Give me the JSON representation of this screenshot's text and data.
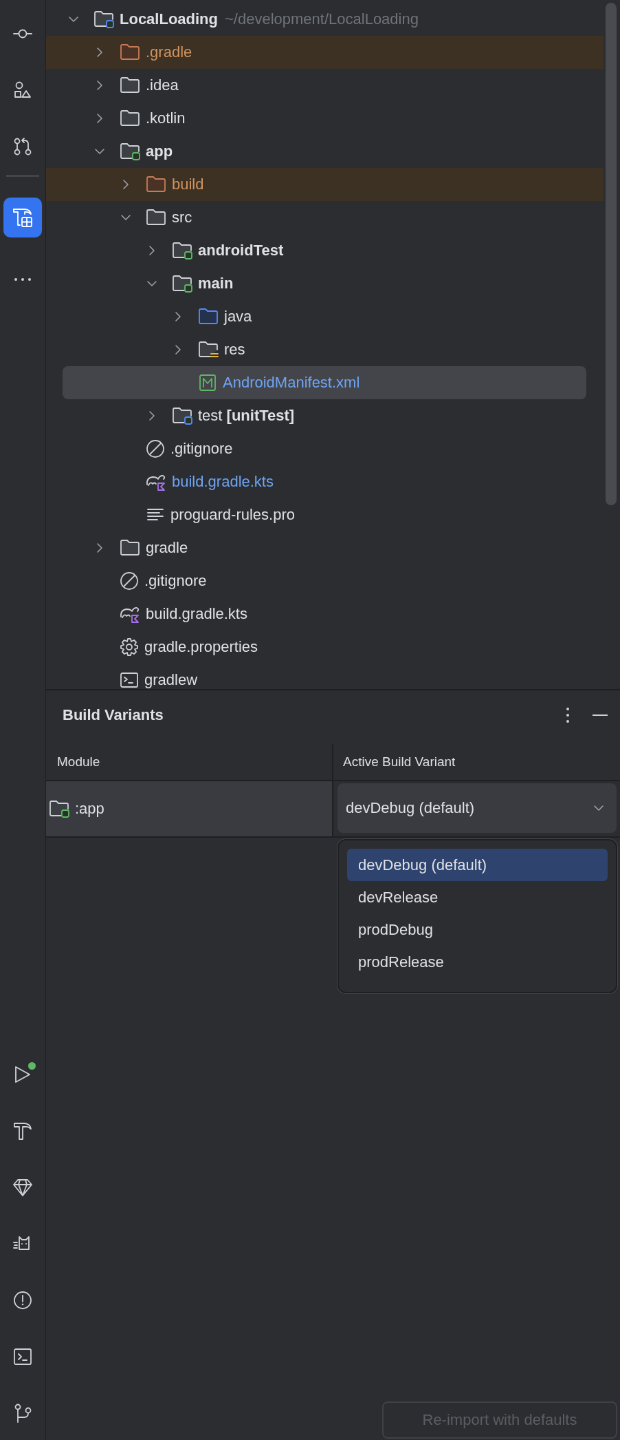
{
  "tool_strip": {
    "top": [
      {
        "kind": "commit",
        "selected": false
      },
      {
        "kind": "structure",
        "selected": false
      },
      {
        "kind": "pull-requests",
        "selected": false
      }
    ],
    "middle": [
      {
        "kind": "build-variants",
        "selected": true
      },
      {
        "kind": "more",
        "selected": false
      }
    ],
    "bottom": [
      {
        "kind": "run",
        "selected": false,
        "running": true
      },
      {
        "kind": "build",
        "selected": false,
        "running": false
      },
      {
        "kind": "gem",
        "selected": false,
        "running": false
      },
      {
        "kind": "logcat",
        "selected": false,
        "running": false
      },
      {
        "kind": "problems",
        "selected": false,
        "running": false
      },
      {
        "kind": "terminal",
        "selected": false,
        "running": false
      },
      {
        "kind": "git",
        "selected": false,
        "running": false
      }
    ]
  },
  "tree": [
    {
      "kind": "project",
      "label": "LocalLoading",
      "hint": "~/development/LocalLoading",
      "bold": true,
      "expanded": true,
      "selected": false,
      "excluded": false,
      "modified": false,
      "children": [
        {
          "kind": "folder",
          "label": ".gradle",
          "bold": false,
          "expanded": false,
          "selected": false,
          "excluded": true,
          "modified": false
        },
        {
          "kind": "folder",
          "label": ".idea",
          "bold": false,
          "expanded": false,
          "selected": false,
          "excluded": false,
          "modified": false
        },
        {
          "kind": "folder",
          "label": ".kotlin",
          "bold": false,
          "expanded": false,
          "selected": false,
          "excluded": false,
          "modified": false
        },
        {
          "kind": "module",
          "label": "app",
          "bold": true,
          "expanded": true,
          "selected": false,
          "excluded": false,
          "modified": false,
          "children": [
            {
              "kind": "folder",
              "label": "build",
              "bold": false,
              "expanded": false,
              "selected": false,
              "excluded": true,
              "modified": false
            },
            {
              "kind": "folder",
              "label": "src",
              "bold": false,
              "expanded": true,
              "selected": false,
              "excluded": false,
              "modified": false,
              "children": [
                {
                  "kind": "module",
                  "label": "androidTest",
                  "bold": true,
                  "expanded": false,
                  "selected": false,
                  "excluded": false,
                  "modified": false
                },
                {
                  "kind": "module",
                  "label": "main",
                  "bold": true,
                  "expanded": true,
                  "selected": false,
                  "excluded": false,
                  "modified": false,
                  "children": [
                    {
                      "kind": "source",
                      "label": "java",
                      "bold": false,
                      "expanded": false,
                      "selected": false,
                      "excluded": false,
                      "modified": false
                    },
                    {
                      "kind": "resources",
                      "label": "res",
                      "bold": false,
                      "expanded": false,
                      "selected": false,
                      "excluded": false,
                      "modified": false
                    },
                    {
                      "kind": "manifest",
                      "label": "AndroidManifest.xml",
                      "bold": false,
                      "selected": true,
                      "excluded": false,
                      "modified": true
                    }
                  ]
                },
                {
                  "kind": "test-root",
                  "label": "test **[unitTest]**",
                  "bold": false,
                  "expanded": false,
                  "selected": false,
                  "excluded": false,
                  "modified": false
                }
              ]
            },
            {
              "kind": "ignore",
              "label": ".gitignore",
              "bold": false,
              "selected": false,
              "excluded": false,
              "modified": false
            },
            {
              "kind": "gradle",
              "label": "build.gradle.kts",
              "bold": false,
              "selected": false,
              "excluded": false,
              "modified": true
            },
            {
              "kind": "text",
              "label": "proguard-rules.pro",
              "bold": false,
              "selected": false,
              "excluded": false,
              "modified": false
            }
          ]
        },
        {
          "kind": "folder",
          "label": "gradle",
          "bold": false,
          "expanded": false,
          "selected": false,
          "excluded": false,
          "modified": false
        },
        {
          "kind": "ignore",
          "label": ".gitignore",
          "bold": false,
          "selected": false,
          "excluded": false,
          "modified": false
        },
        {
          "kind": "gradle",
          "label": "build.gradle.kts",
          "bold": false,
          "selected": false,
          "excluded": false,
          "modified": false
        },
        {
          "kind": "settings",
          "label": "gradle.properties",
          "bold": false,
          "selected": false,
          "excluded": false,
          "modified": false
        },
        {
          "kind": "terminal",
          "label": "gradlew",
          "bold": false,
          "selected": false,
          "excluded": false,
          "modified": false
        }
      ]
    }
  ],
  "build_variants": {
    "title": "Build Variants",
    "columns": [
      "Module",
      "Active Build Variant"
    ],
    "rows": [
      {
        "module": ":app",
        "variant": "devDebug (default)",
        "dropdown_open": true
      }
    ],
    "options": [
      {
        "label": "devDebug (default)",
        "selected": true
      },
      {
        "label": "devRelease",
        "selected": false
      },
      {
        "label": "prodDebug",
        "selected": false
      },
      {
        "label": "prodRelease",
        "selected": false
      }
    ],
    "reimport_button": {
      "label": "Re-import with defaults",
      "disabled": true
    }
  }
}
